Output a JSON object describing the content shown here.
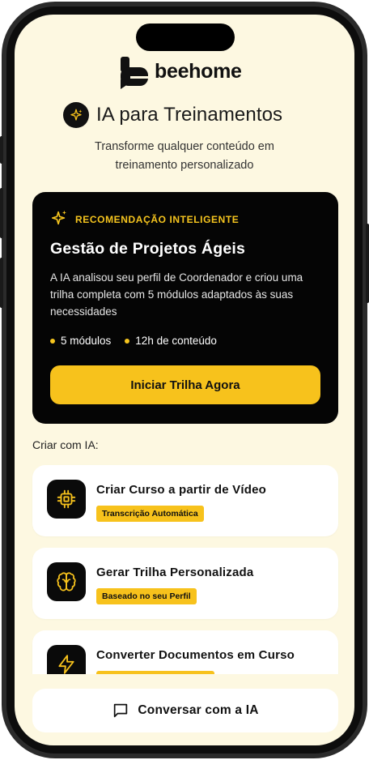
{
  "brand": {
    "name": "beehome"
  },
  "header": {
    "title": "IA para Treinamentos",
    "subtitle_line1": "Transforme qualquer conteúdo em",
    "subtitle_line2": "treinamento personalizado"
  },
  "recommendation": {
    "tag": "RECOMENDAÇÃO INTELIGENTE",
    "title": "Gestão de Projetos Ágeis",
    "description": "A IA analisou seu perfil de Coordenador e criou uma trilha completa com 5 módulos adaptados às suas necessidades",
    "meta": [
      "5 módulos",
      "12h de conteúdo"
    ],
    "button_label": "Iniciar Trilha Agora"
  },
  "create_section": {
    "label": "Criar com IA:",
    "items": [
      {
        "title": "Criar Curso a partir de Vídeo",
        "badge": "Transcrição Automática",
        "icon": "chip-icon"
      },
      {
        "title": "Gerar Trilha Personalizada",
        "badge": "Baseado no seu Perfil",
        "icon": "brain-icon"
      },
      {
        "title": "Converter Documentos em Curso",
        "badge": "",
        "icon": "lightning-icon"
      }
    ]
  },
  "chat": {
    "label": "Conversar com a IA",
    "icon": "chat-bubble-icon"
  },
  "colors": {
    "accent": "#F7C21C",
    "background": "#FDF8E1",
    "dark": "#050505"
  }
}
